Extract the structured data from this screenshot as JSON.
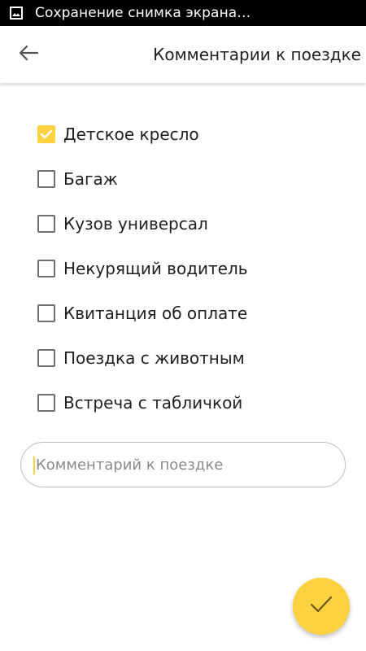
{
  "status_bar": {
    "notification_text": "Сохранение снимка экрана…",
    "icon": "image-icon"
  },
  "toolbar": {
    "back_icon": "arrow-left-icon",
    "title": "Комментарии к поездке"
  },
  "options": [
    {
      "label": "Детское кресло",
      "checked": true
    },
    {
      "label": "Багаж",
      "checked": false
    },
    {
      "label": "Кузов универсал",
      "checked": false
    },
    {
      "label": "Некурящий водитель",
      "checked": false
    },
    {
      "label": "Квитанция об оплате",
      "checked": false
    },
    {
      "label": "Поездка с животным",
      "checked": false
    },
    {
      "label": "Встреча с табличкой",
      "checked": false
    }
  ],
  "comment": {
    "placeholder": "Комментарий к поездке",
    "value": ""
  },
  "fab": {
    "icon": "checkmark-icon"
  },
  "colors": {
    "accent": "#fdd240",
    "status_bar": "#000000",
    "checkbox_border": "#6e6e6e",
    "text": "#202020"
  }
}
